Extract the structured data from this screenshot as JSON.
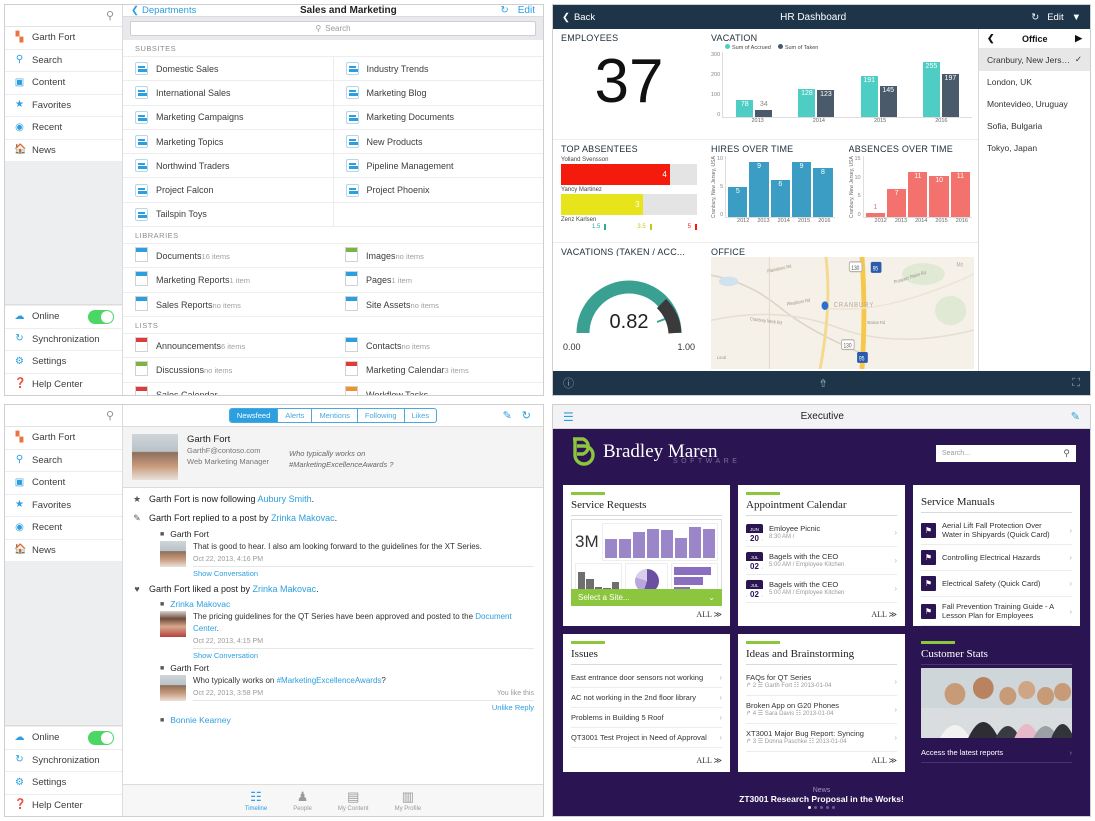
{
  "panel1": {
    "header": {
      "back": "Departments",
      "title": "Sales and Marketing",
      "refresh_icon": "refresh-icon",
      "edit": "Edit",
      "pin_icon": "pin-icon"
    },
    "search": {
      "placeholder": "Search",
      "icon": "search-icon"
    },
    "sidebar": {
      "items": [
        {
          "label": "Garth Fort",
          "icon": "user-profile-icon"
        },
        {
          "label": "Search",
          "icon": "search-icon"
        },
        {
          "label": "Content",
          "icon": "content-icon"
        },
        {
          "label": "Favorites",
          "icon": "star-icon"
        },
        {
          "label": "Recent",
          "icon": "clock-icon"
        },
        {
          "label": "News",
          "icon": "home-icon"
        }
      ],
      "bottom": [
        {
          "label": "Online",
          "icon": "cloud-icon",
          "toggle": "on"
        },
        {
          "label": "Synchronization",
          "icon": "sync-icon"
        },
        {
          "label": "Settings",
          "icon": "gear-icon"
        },
        {
          "label": "Help Center",
          "icon": "help-icon"
        }
      ]
    },
    "sections": [
      {
        "title": "SUBSITES",
        "type": "sites",
        "rows": [
          [
            "Domestic Sales",
            "Industry Trends"
          ],
          [
            "International Sales",
            "Marketing Blog"
          ],
          [
            "Marketing Campaigns",
            "Marketing Documents"
          ],
          [
            "Marketing Topics",
            "New Products"
          ],
          [
            "Northwind Traders",
            "Pipeline Management"
          ],
          [
            "Project Falcon",
            "Project Phoenix"
          ],
          [
            "Tailspin Toys",
            ""
          ]
        ]
      },
      {
        "title": "LIBRARIES",
        "type": "libs",
        "rows": [
          [
            {
              "name": "Documents",
              "count": "16 items",
              "color": "blue"
            },
            {
              "name": "Images",
              "count": "no items",
              "color": "green"
            }
          ],
          [
            {
              "name": "Marketing Reports",
              "count": "1 item",
              "color": "blue"
            },
            {
              "name": "Pages",
              "count": "1 item",
              "color": "blue"
            }
          ],
          [
            {
              "name": "Sales Reports",
              "count": "no items",
              "color": "blue"
            },
            {
              "name": "Site Assets",
              "count": "no items",
              "color": "blue"
            }
          ]
        ]
      },
      {
        "title": "LISTS",
        "type": "libs",
        "rows": [
          [
            {
              "name": "Announcements",
              "count": "6 items",
              "color": "red"
            },
            {
              "name": "Contacts",
              "count": "no items",
              "color": "blue"
            }
          ],
          [
            {
              "name": "Discussions",
              "count": "no items",
              "color": "green"
            },
            {
              "name": "Marketing Calendar",
              "count": "3 items",
              "color": "red"
            }
          ],
          [
            {
              "name": "Sales Calendar",
              "count": "",
              "color": "red"
            },
            {
              "name": "Workflow Tasks",
              "count": "",
              "color": "orange"
            }
          ]
        ]
      }
    ]
  },
  "panel2": {
    "header": {
      "back": "Back",
      "title": "HR Dashboard",
      "refresh_icon": "refresh-icon",
      "edit": "Edit",
      "filter_icon": "filter-icon"
    },
    "employees": {
      "title": "EMPLOYEES",
      "value": "37"
    },
    "office_list": {
      "title": "Office",
      "prev_icon": "chevron-left-icon",
      "next_icon": "chevron-right-icon",
      "items": [
        "Cranbury, New Jersey...",
        "London, UK",
        "Montevideo, Uruguay",
        "Sofia, Bulgaria",
        "Tokyo, Japan"
      ],
      "selected": "Cranbury, New Jersey...",
      "check_icon": "check-icon"
    },
    "footer": {
      "help_icon": "help-circle-icon",
      "share_icon": "share-icon",
      "expand_icon": "expand-icon"
    },
    "gauge": {
      "title": "VACATIONS (TAKEN / ACC...",
      "value": "0.82",
      "min": "0.00",
      "max": "1.00"
    },
    "office_map": {
      "title": "OFFICE",
      "city": "CRANBURY",
      "roads": [
        "Pleasboro Rd",
        "Cranbury Neck Rd",
        "Station Rd",
        "Prospect Plains Rd",
        "Dey Rd"
      ],
      "shields": [
        "130",
        "95",
        "130",
        "95"
      ]
    },
    "chart_data": [
      {
        "type": "bar",
        "title": "VACATION",
        "categories": [
          "2013",
          "2014",
          "2015",
          "2016"
        ],
        "series": [
          {
            "name": "Sum of Accrued",
            "values": [
              78,
              128,
              191,
              255
            ],
            "color": "#4ecdc4"
          },
          {
            "name": "Sum of Taken",
            "values": [
              34,
              123,
              145,
              197
            ],
            "color": "#4a5a6a"
          }
        ],
        "ylim": [
          0,
          300
        ],
        "yticks": [
          "0",
          "100",
          "200",
          "300"
        ],
        "xlabel": "",
        "ylabel": "",
        "legend": "top"
      },
      {
        "type": "bar",
        "title": "TOP ABSENTEES",
        "categories": [
          "Yolland Svensson",
          "Yancy Martinez",
          "Zenz Karlsen"
        ],
        "values": [
          4,
          3,
          null
        ],
        "colors": [
          "#f41b0c",
          "#e8e41c",
          "#cccccc"
        ],
        "ticks": [
          "1.5",
          "3.5",
          "5"
        ],
        "xlim": [
          0,
          5
        ]
      },
      {
        "type": "bar",
        "title": "HIRES OVER TIME",
        "ylabel": "Cranbury, New Jersey, USA",
        "categories": [
          "2012",
          "2013",
          "2014",
          "2015",
          "2016"
        ],
        "values": [
          5,
          9,
          6,
          9,
          8
        ],
        "ylim": [
          0,
          10
        ],
        "yticks": [
          "0",
          "5",
          "10"
        ],
        "color": "#3b9cc4"
      },
      {
        "type": "bar",
        "title": "ABSENCES OVER TIME",
        "ylabel": "Cranbury, New Jersey, USA",
        "categories": [
          "2012",
          "2013",
          "2014",
          "2015",
          "2016"
        ],
        "values": [
          1,
          7,
          11,
          10,
          11
        ],
        "ylim": [
          0,
          15
        ],
        "yticks": [
          "0",
          "5",
          "10",
          "15"
        ],
        "color": "#f4726e"
      },
      {
        "type": "gauge",
        "title": "VACATIONS (TAKEN / ACC...",
        "value": 0.82,
        "min": 0.0,
        "max": 1.0,
        "color": "#3aa192"
      }
    ]
  },
  "panel3": {
    "tabs": [
      {
        "label": "Newsfeed",
        "active": true
      },
      {
        "label": "Alerts",
        "active": false
      },
      {
        "label": "Mentions",
        "active": false
      },
      {
        "label": "Following",
        "active": false
      },
      {
        "label": "Likes",
        "active": false
      }
    ],
    "header_icons": {
      "compose": "compose-icon",
      "refresh": "refresh-icon",
      "pin": "pin-icon"
    },
    "sidebar": {
      "items": [
        {
          "label": "Garth Fort",
          "icon": "user-profile-icon"
        },
        {
          "label": "Search",
          "icon": "search-icon"
        },
        {
          "label": "Content",
          "icon": "content-icon"
        },
        {
          "label": "Favorites",
          "icon": "star-icon"
        },
        {
          "label": "Recent",
          "icon": "clock-icon"
        },
        {
          "label": "News",
          "icon": "home-icon"
        }
      ],
      "bottom": [
        {
          "label": "Online",
          "icon": "cloud-icon",
          "toggle": "on"
        },
        {
          "label": "Synchronization",
          "icon": "sync-icon"
        },
        {
          "label": "Settings",
          "icon": "gear-icon"
        },
        {
          "label": "Help Center",
          "icon": "help-icon"
        }
      ]
    },
    "profile": {
      "name": "Garth Fort",
      "email": "GarthF@contoso.com",
      "role": "Web Marketing Manager",
      "status_line1": "Who typically works on",
      "status_line2": "#MarketingExcellenceAwards ?"
    },
    "feed": [
      {
        "icon": "star-icon",
        "text_pre": "Garth Fort is now following ",
        "link": "Aubury Smith",
        "text_post": "."
      },
      {
        "icon": "pencil-icon",
        "text_pre": "Garth Fort replied to a post by ",
        "link": "Zrinka Makovac",
        "text_post": "."
      },
      {
        "type": "post",
        "author": "Garth Fort",
        "body": "That is good to hear. I also am looking forward to the guidelines for the XT Series.",
        "meta": "Oct 22, 2013, 4:16 PM",
        "show": "Show Conversation"
      },
      {
        "icon": "heart-icon",
        "text_pre": "Garth Fort liked a post by ",
        "link": "Zrinka Makovac",
        "text_post": "."
      },
      {
        "type": "post",
        "author": "Zrinka Makovac",
        "author_link": true,
        "body": "The pricing guidelines for the QT Series have been approved and posted to the ",
        "body_link": "Document Center",
        "body_post": ".",
        "meta": "Oct 22, 2013, 4:15 PM",
        "show": "Show Conversation"
      },
      {
        "type": "post",
        "author": "Garth Fort",
        "body": "Who typically works on ",
        "body_link": "#MarketingExcellenceAwards",
        "body_post": "?",
        "meta": "Oct 22, 2013, 3:58 PM",
        "meta_right": "You like this",
        "actions": "Unlike  Reply"
      },
      {
        "type": "post",
        "author": "Bonnie Kearney",
        "author_link": true
      }
    ],
    "tabbar": [
      {
        "label": "Timeline",
        "icon": "timeline-icon",
        "active": true
      },
      {
        "label": "People",
        "icon": "people-icon",
        "active": false
      },
      {
        "label": "My Content",
        "icon": "content-box-icon",
        "active": false
      },
      {
        "label": "My Profile",
        "icon": "profile-card-icon",
        "active": false
      }
    ]
  },
  "panel4": {
    "header": {
      "menu_icon": "hamburger-menu-icon",
      "title": "Executive",
      "edit_icon": "pencil-edit-icon"
    },
    "brand": {
      "name": "Bradley Maren",
      "sub": "SOFTWARE",
      "logo_icon": "bm-logo-icon"
    },
    "search": {
      "placeholder": "Search...",
      "icon": "search-icon"
    },
    "cards": [
      {
        "title": "Service Requests",
        "type": "report",
        "kpi": "3M",
        "select_label": "Select a Site...",
        "all": "ALL ≫"
      },
      {
        "title": "Appointment Calendar",
        "type": "events",
        "items": [
          {
            "month": "JUN",
            "day": "20",
            "name": "Emloyee Picnic",
            "sub": "8:30 AM /"
          },
          {
            "month": "JUL",
            "day": "02",
            "name": "Bagels with the CEO",
            "sub": "5:00 AM / Employee Kitchen"
          },
          {
            "month": "JUL",
            "day": "02",
            "name": "Bagels with the CEO",
            "sub": "5:00 AM / Employee Kitchen"
          }
        ],
        "all": "ALL ≫"
      },
      {
        "title": "Service Manuals",
        "type": "docs",
        "items": [
          {
            "name": "Aerial Lift Fall Protection Over Water in Shipyards (Quick Card)"
          },
          {
            "name": "Controlling Electrical Hazards"
          },
          {
            "name": "Electrical Safety (Quick Card)"
          },
          {
            "name": "Fall Prevention Training Guide - A Lesson Plan for Employees"
          }
        ],
        "all": "ALL ≫"
      },
      {
        "title": "Issues",
        "type": "links",
        "items": [
          {
            "name": "East entrance door sensors not working"
          },
          {
            "name": "AC not working in the 2nd floor library"
          },
          {
            "name": "Problems in Building 5 Roof"
          },
          {
            "name": "QT3001 Test Project in Need of Approval"
          }
        ],
        "all": "ALL ≫"
      },
      {
        "title": "Ideas and Brainstorming",
        "type": "ideas",
        "items": [
          {
            "name": "FAQs for QT Series",
            "replies": "2",
            "author": "Garth Fort",
            "date": "2013-01-04"
          },
          {
            "name": "Broken App on G20 Phones",
            "replies": "4",
            "author": "Sara Davis",
            "date": "2013-01-04"
          },
          {
            "name": "XT3001 Major Bug Report: Syncing",
            "replies": "3",
            "author": "Donna Paschke",
            "date": "2013-01-04"
          }
        ],
        "all": "ALL ≫"
      },
      {
        "title": "Customer Stats",
        "type": "dark",
        "link": "Access the latest reports"
      }
    ],
    "newsbar": {
      "label": "News",
      "headline": "ZT3001 Research Proposal in the Works!",
      "dots": 5,
      "active_dot": 0
    }
  }
}
